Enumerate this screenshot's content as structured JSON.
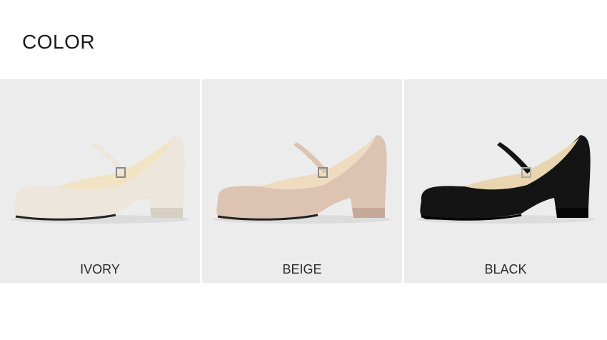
{
  "section": {
    "title": "COLOR"
  },
  "swatches": [
    {
      "label": "IVORY",
      "color": "#ece6dc",
      "shade": "#d7cfc2",
      "lining": "#f1e3c4"
    },
    {
      "label": "BEIGE",
      "color": "#dcc3b2",
      "shade": "#c6a998",
      "lining": "#efdcc0"
    },
    {
      "label": "BLACK",
      "color": "#141414",
      "shade": "#050505",
      "lining": "#e9d6b1"
    }
  ]
}
